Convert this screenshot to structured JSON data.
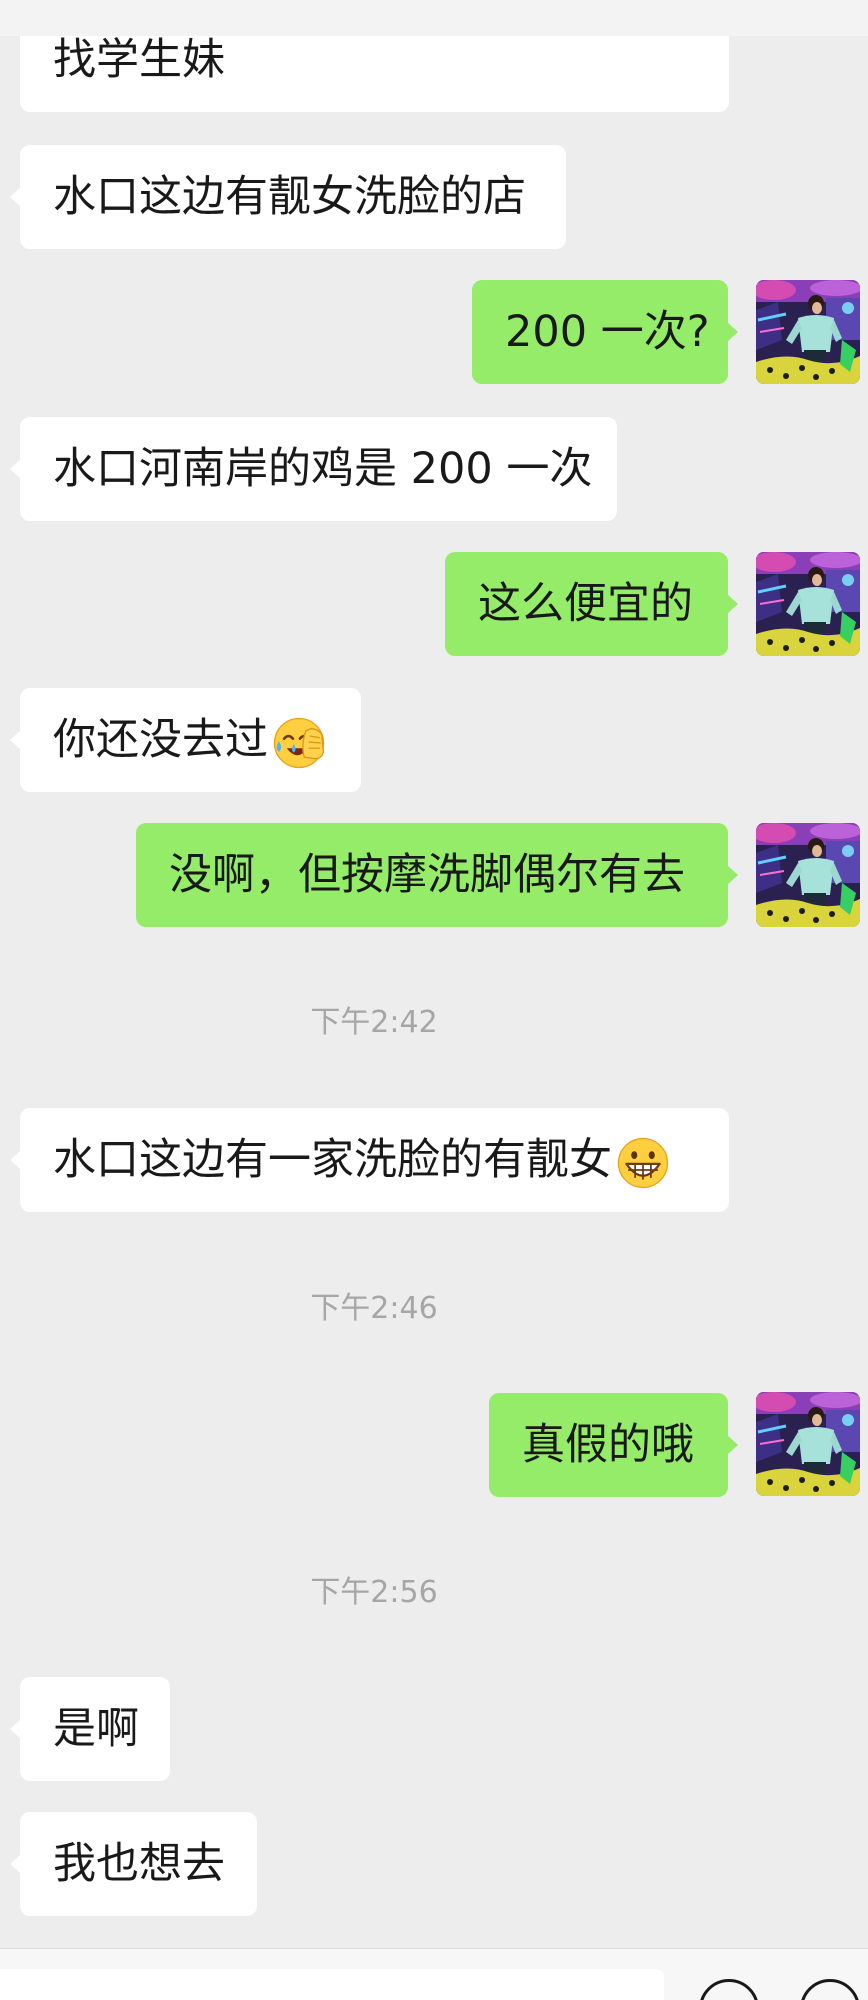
{
  "colors": {
    "chat_background": "#ededed",
    "header_background": "#f3f3f3",
    "received_bubble": "#ffffff",
    "sent_bubble": "#95ec69",
    "text": "#191919",
    "timestamp": "#a6a6a6",
    "input_bar_background": "#f7f7f7"
  },
  "icons": {
    "avatar": "user-avatar-photo",
    "facepalm": "facepalm-emoji-icon",
    "grin": "grin-emoji-icon",
    "input_buttons": [
      "smiley-icon",
      "plus-icon"
    ]
  },
  "chat": {
    "items": [
      {
        "sent": false,
        "text": "找学生妹"
      },
      {
        "sent": false,
        "text": "水口这边有靓女洗脸的店"
      },
      {
        "sent": true,
        "text": "200 一次?"
      },
      {
        "sent": false,
        "text": "水口河南岸的鸡是 200 一次"
      },
      {
        "sent": true,
        "text": "这么便宜的"
      },
      {
        "sent": false,
        "text": "你还没去过",
        "emoji": "facepalm-emoji-icon"
      },
      {
        "sent": true,
        "text": "没啊，但按摩洗脚偶尔有去"
      },
      {
        "timestamp": "下午2:42"
      },
      {
        "sent": false,
        "text": "水口这边有一家洗脸的有靓女",
        "emoji": "grin-emoji-icon"
      },
      {
        "timestamp": "下午2:46"
      },
      {
        "sent": true,
        "text": "真假的哦"
      },
      {
        "timestamp": "下午2:56"
      },
      {
        "sent": false,
        "text": "是啊"
      },
      {
        "sent": false,
        "text": "我也想去"
      }
    ]
  },
  "input_bar": {
    "input_value": ""
  }
}
